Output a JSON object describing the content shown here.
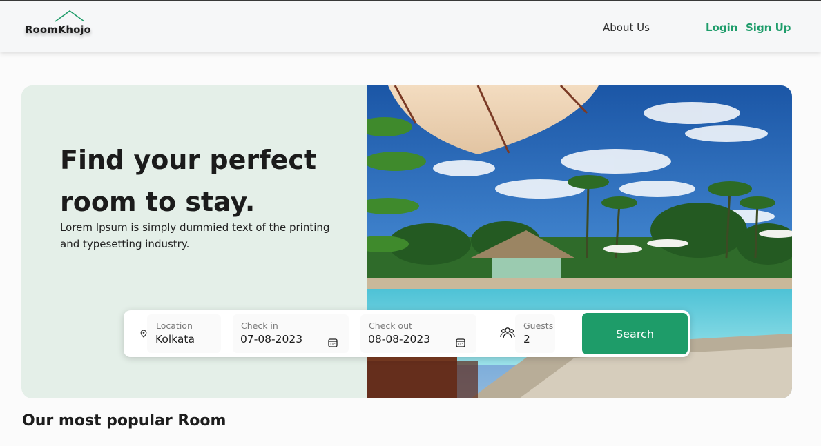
{
  "brand": {
    "name": "RoomKhojo",
    "accent": "#1e9c69"
  },
  "nav": {
    "about": "About Us",
    "login": "Login",
    "signup": "Sign Up"
  },
  "hero": {
    "title": "Find your perfect room to stay.",
    "subtitle": "Lorem Ipsum is simply dummied text of the printing and typesetting industry.",
    "image": "resort-pool-with-umbrella-and-palm-trees"
  },
  "search": {
    "location": {
      "label": "Location",
      "value": "Kolkata",
      "icon": "location-pin-icon"
    },
    "checkin": {
      "label": "Check in",
      "value": "07-08-2023",
      "icon": "calendar-icon"
    },
    "checkout": {
      "label": "Check out",
      "value": "08-08-2023",
      "icon": "calendar-icon"
    },
    "guests": {
      "label": "Guests",
      "value": "2",
      "icon": "users-icon"
    },
    "button": "Search"
  },
  "popular": {
    "title": "Our most popular Room"
  }
}
